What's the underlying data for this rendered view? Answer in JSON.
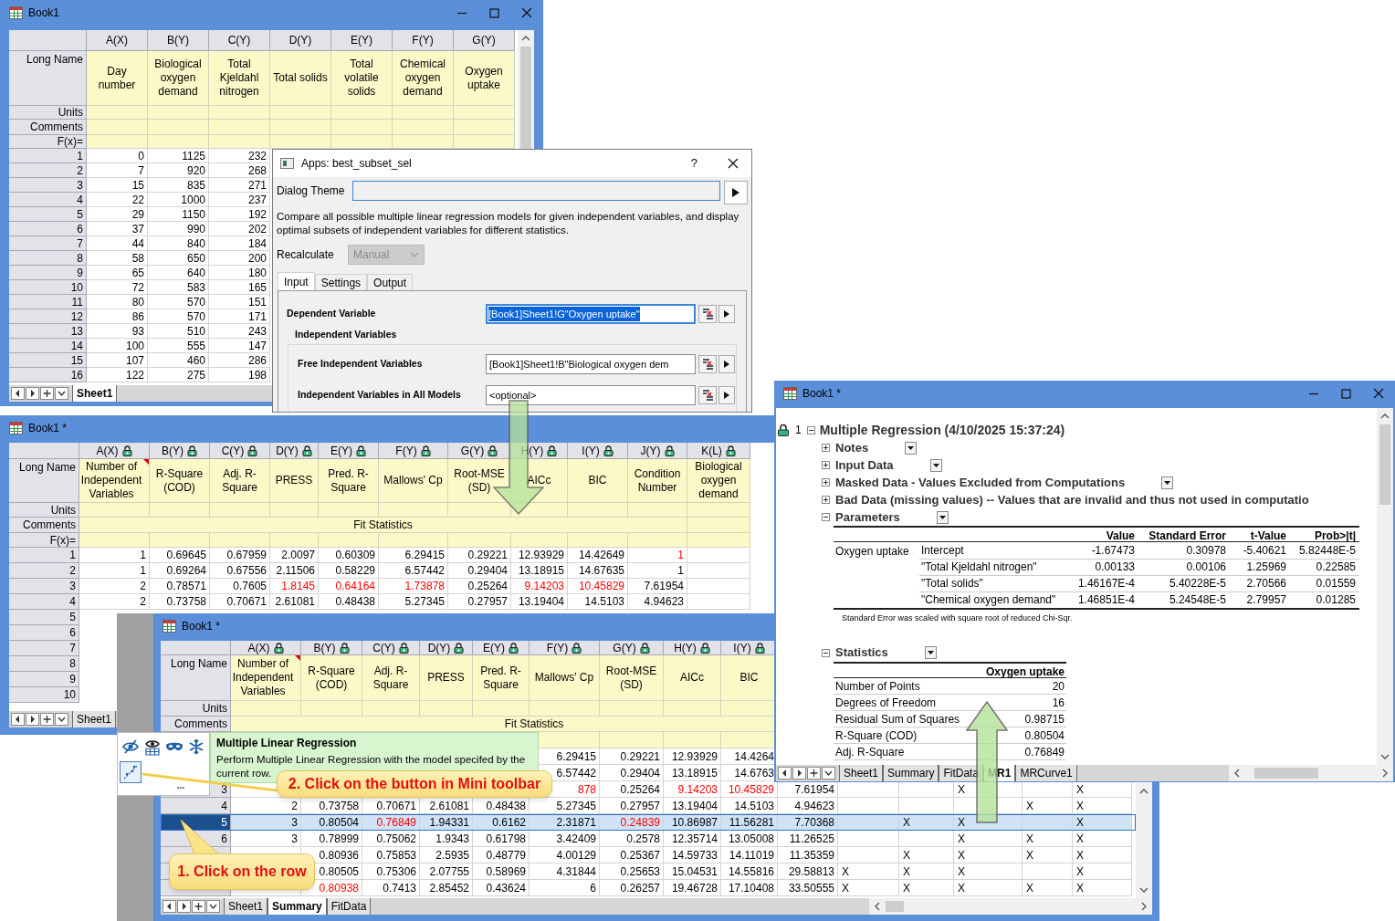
{
  "book1": {
    "title": "Book1",
    "columns": [
      {
        "name": "A(X)",
        "long_name": "Day number"
      },
      {
        "name": "B(Y)",
        "long_name": "Biological oxygen demand"
      },
      {
        "name": "C(Y)",
        "long_name": "Total Kjeldahl nitrogen"
      },
      {
        "name": "D(Y)",
        "long_name": "Total solids"
      },
      {
        "name": "E(Y)",
        "long_name": "Total volatile solids"
      },
      {
        "name": "F(Y)",
        "long_name": "Chemical oxygen demand"
      },
      {
        "name": "G(Y)",
        "long_name": "Oxygen uptake"
      }
    ],
    "row_labels": [
      "Long Name",
      "Units",
      "Comments",
      "F(x)="
    ],
    "rows": [
      {
        "number": "1",
        "cells": [
          "0",
          "1125",
          "232"
        ]
      },
      {
        "number": "2",
        "cells": [
          "7",
          "920",
          "268"
        ]
      },
      {
        "number": "3",
        "cells": [
          "15",
          "835",
          "271"
        ]
      },
      {
        "number": "4",
        "cells": [
          "22",
          "1000",
          "237"
        ]
      },
      {
        "number": "5",
        "cells": [
          "29",
          "1150",
          "192"
        ]
      },
      {
        "number": "6",
        "cells": [
          "37",
          "990",
          "202"
        ]
      },
      {
        "number": "7",
        "cells": [
          "44",
          "840",
          "184"
        ]
      },
      {
        "number": "8",
        "cells": [
          "58",
          "650",
          "200"
        ]
      },
      {
        "number": "9",
        "cells": [
          "65",
          "640",
          "180"
        ]
      },
      {
        "number": "10",
        "cells": [
          "72",
          "583",
          "165"
        ]
      },
      {
        "number": "11",
        "cells": [
          "80",
          "570",
          "151"
        ]
      },
      {
        "number": "12",
        "cells": [
          "86",
          "570",
          "171"
        ]
      },
      {
        "number": "13",
        "cells": [
          "93",
          "510",
          "243"
        ]
      },
      {
        "number": "14",
        "cells": [
          "100",
          "555",
          "147"
        ]
      },
      {
        "number": "15",
        "cells": [
          "107",
          "460",
          "286"
        ]
      },
      {
        "number": "16",
        "cells": [
          "122",
          "275",
          "198"
        ]
      }
    ],
    "sheet_tabs": [
      {
        "label": "Sheet1",
        "selected": true
      }
    ]
  },
  "app_dialog": {
    "title": "Apps: best_subset_sel",
    "help": "?",
    "theme_label": "Dialog Theme",
    "description": "Compare all possible multiple linear regression models for given independent variables, and display optimal subsets of independent variables for different statistics.",
    "recalculate_label": "Recalculate",
    "recalculate": {
      "value": "Manual",
      "disabled": true
    },
    "tabs": [
      {
        "label": "Input",
        "selected": true
      },
      {
        "label": "Settings",
        "selected": false
      },
      {
        "label": "Output",
        "selected": false
      }
    ],
    "dependent": {
      "label": "Dependent Variable",
      "value": "[Book1]Sheet1!G\"Oxygen uptake\"",
      "text_selected": true
    },
    "group_label": "Independent Variables",
    "free": {
      "label": "Free Independent Variables",
      "value": "[Book1]Sheet1!B\"Biological oxygen dem"
    },
    "all_models": {
      "label": "Independent Variables in All Models",
      "placeholder": "<optional>"
    }
  },
  "summary_back": {
    "title": "Book1 *",
    "columns": [
      {
        "name": "A(X)",
        "locked": true,
        "comment_mark": true,
        "long_name": "Number of Independent Variables"
      },
      {
        "name": "B(Y)",
        "locked": true,
        "comment_mark": false,
        "long_name": "R-Square (COD)"
      },
      {
        "name": "C(Y)",
        "locked": true,
        "comment_mark": false,
        "long_name": "Adj. R-Square"
      },
      {
        "name": "D(Y)",
        "locked": true,
        "comment_mark": false,
        "long_name": "PRESS"
      },
      {
        "name": "E(Y)",
        "locked": true,
        "comment_mark": false,
        "long_name": "Pred. R-Square"
      },
      {
        "name": "F(Y)",
        "locked": true,
        "comment_mark": false,
        "long_name": "Mallows' Cp"
      },
      {
        "name": "G(Y)",
        "locked": true,
        "comment_mark": false,
        "long_name": "Root-MSE (SD)"
      },
      {
        "name": "H(Y)",
        "locked": true,
        "comment_mark": false,
        "long_name": "AICc"
      },
      {
        "name": "I(Y)",
        "locked": true,
        "comment_mark": false,
        "long_name": "BIC"
      },
      {
        "name": "J(Y)",
        "locked": true,
        "comment_mark": false,
        "long_name": "Condition Number"
      },
      {
        "name": "K(L)",
        "locked": true,
        "comment_mark": false,
        "long_name": "Biological oxygen demand"
      }
    ],
    "row_labels": [
      "Long Name",
      "Units",
      "Comments",
      "F(x)="
    ],
    "comments": "Fit Statistics",
    "rows": [
      {
        "number": "1",
        "cells": [
          "1",
          "0.69645",
          "0.67959",
          "2.0097",
          "0.60309",
          "6.29415",
          "0.29221",
          "12.93929",
          "14.42649",
          {
            "text": "1",
            "flagged": true
          }
        ]
      },
      {
        "number": "2",
        "cells": [
          "1",
          "0.69264",
          "0.67556",
          "2.11506",
          "0.58229",
          "6.57442",
          "0.29404",
          "13.18915",
          "14.67635",
          "1"
        ]
      },
      {
        "number": "3",
        "cells": [
          "2",
          "0.78571",
          "0.7605",
          {
            "text": "1.8145",
            "flagged": true
          },
          {
            "text": "0.64164",
            "flagged": true
          },
          {
            "text": "1.73878",
            "flagged": true
          },
          "0.25264",
          {
            "text": "9.14203",
            "flagged": true
          },
          {
            "text": "10.45829",
            "flagged": true
          },
          "7.61954"
        ]
      },
      {
        "number": "4",
        "cells": [
          "2",
          "0.73758",
          "0.70671",
          "2.61081",
          "0.48438",
          "5.27345",
          "0.27957",
          "13.19404",
          "14.5103",
          "4.94623"
        ]
      },
      {
        "number": "5"
      },
      {
        "number": "6"
      },
      {
        "number": "7"
      },
      {
        "number": "8"
      },
      {
        "number": "9"
      },
      {
        "number": "10"
      }
    ],
    "sheet_tabs": [
      {
        "label": "Sheet1",
        "selected": false
      }
    ]
  },
  "summary_front": {
    "title": "Book1 *",
    "columns": [
      {
        "name": "A(X)",
        "locked": true,
        "comment_mark": true,
        "long_name": "Number of Independent Variables"
      },
      {
        "name": "B(Y)",
        "locked": true,
        "comment_mark": false,
        "long_name": "R-Square (COD)"
      },
      {
        "name": "C(Y)",
        "locked": true,
        "comment_mark": false,
        "long_name": "Adj. R-Square"
      },
      {
        "name": "D(Y)",
        "locked": true,
        "comment_mark": false,
        "long_name": "PRESS"
      },
      {
        "name": "E(Y)",
        "locked": true,
        "comment_mark": false,
        "long_name": "Pred. R-Square"
      },
      {
        "name": "F(Y)",
        "locked": true,
        "comment_mark": false,
        "long_name": "Mallows' Cp"
      },
      {
        "name": "G(Y)",
        "locked": true,
        "comment_mark": false,
        "long_name": "Root-MSE (SD)"
      },
      {
        "name": "H(Y)",
        "locked": true,
        "comment_mark": false,
        "long_name": "AICc"
      },
      {
        "name": "I(Y)",
        "locked": true,
        "comment_mark": false,
        "long_name": "BIC"
      }
    ],
    "row_labels": [
      "Long Name",
      "Units",
      "Comments"
    ],
    "comments": "Fit Statistics",
    "rows": [
      {
        "selected": false,
        "cells": [
          null,
          null,
          null,
          null,
          null,
          "6.29415",
          "0.29221",
          "12.93929",
          "14.4264"
        ]
      },
      {
        "selected": false,
        "cells": [
          null,
          null,
          null,
          null,
          null,
          "6.57442",
          "0.29404",
          "13.18915",
          "14.6763"
        ]
      },
      {
        "number": "3",
        "selected": false,
        "cells": [
          null,
          null,
          null,
          null,
          null,
          {
            "text": "878",
            "flagged": true
          },
          "0.25264",
          {
            "text": "9.14203",
            "flagged": true
          },
          {
            "text": "10.45829",
            "flagged": true
          },
          "7.61954",
          null,
          null,
          "X",
          null,
          "X"
        ]
      },
      {
        "number": "4",
        "selected": false,
        "cells": [
          "2",
          "0.73758",
          "0.70671",
          "2.61081",
          "0.48438",
          "5.27345",
          "0.27957",
          "13.19404",
          "14.5103",
          "4.94623",
          null,
          null,
          null,
          "X",
          "X"
        ]
      },
      {
        "number": "5",
        "selected": true,
        "cells": [
          "3",
          "0.80504",
          {
            "text": "0.76849",
            "flagged": true
          },
          "1.94331",
          "0.6162",
          "2.31871",
          {
            "text": "0.24839",
            "flagged": true
          },
          "10.86987",
          "11.56281",
          "7.70368",
          null,
          "X",
          "X",
          null,
          "X"
        ]
      },
      {
        "number": "6",
        "selected": false,
        "cells": [
          "3",
          "0.78999",
          "0.75062",
          "1.9343",
          "0.61798",
          "3.42409",
          "0.2578",
          "12.35714",
          "13.05008",
          "11.26525",
          null,
          null,
          "X",
          "X",
          "X"
        ]
      },
      {
        "selected": false,
        "cells": [
          null,
          "0.80936",
          "0.75853",
          "2.5935",
          "0.48779",
          "4.00129",
          "0.25367",
          "14.59733",
          "14.11019",
          "11.35359",
          null,
          "X",
          "X",
          "X",
          "X"
        ]
      },
      {
        "selected": false,
        "cells": [
          null,
          "0.80505",
          "0.75306",
          "2.07755",
          "0.58969",
          "4.31844",
          "0.25653",
          "15.04531",
          "14.55816",
          "29.58813",
          "X",
          "X",
          "X",
          null,
          "X"
        ]
      },
      {
        "selected": false,
        "cells": [
          null,
          {
            "text": "0.80938",
            "flagged": true
          },
          "0.7413",
          "2.85452",
          "0.43624",
          "6",
          "0.26257",
          "19.46728",
          "17.10408",
          "33.50555",
          "X",
          "X",
          "X",
          "X",
          "X"
        ]
      }
    ],
    "sheet_tabs": [
      {
        "label": "Sheet1",
        "selected": false
      },
      {
        "label": "Summary",
        "selected": true
      },
      {
        "label": "FitData",
        "selected": false
      }
    ]
  },
  "report": {
    "title": "Book1 *",
    "index": "1",
    "heading": "Multiple Regression (4/10/2025 15:37:24)",
    "expanded": true,
    "sections": [
      {
        "kind": "section",
        "title": "Notes",
        "expanded": false,
        "menu": true
      },
      {
        "kind": "section",
        "title": "Input Data",
        "expanded": false,
        "menu": true
      },
      {
        "kind": "section",
        "title": "Masked Data - Values Excluded from Computations",
        "expanded": false,
        "menu": true
      },
      {
        "kind": "section",
        "title": "Bad Data (missing values) -- Values that are invalid and thus not used in computatio",
        "expanded": false,
        "menu": false
      },
      {
        "kind": "parameters",
        "title": "Parameters",
        "expanded": true,
        "menu": true,
        "columns": [
          "Value",
          "Standard Error",
          "t-Value",
          "Prob>|t|"
        ],
        "group": "Oxygen uptake",
        "rows": [
          {
            "name": "Intercept",
            "values": [
              "-1.67473",
              "0.30978",
              "-5.40621",
              "5.82448E-5"
            ]
          },
          {
            "name": "\"Total Kjeldahl nitrogen\"",
            "values": [
              "0.00133",
              "0.00106",
              "1.25969",
              "0.22585"
            ]
          },
          {
            "name": "\"Total solids\"",
            "values": [
              "1.46167E-4",
              "5.40228E-5",
              "2.70566",
              "0.01559"
            ]
          },
          {
            "name": "\"Chemical oxygen demand\"",
            "values": [
              "1.46851E-4",
              "5.24548E-5",
              "2.79957",
              "0.01285"
            ]
          }
        ],
        "note": "Standard Error was scaled with square root of reduced Chi-Sqr."
      },
      {
        "kind": "statistics",
        "title": "Statistics",
        "expanded": true,
        "menu": true,
        "column": "Oxygen uptake",
        "rows": [
          {
            "label": "Number of Points",
            "value": "20"
          },
          {
            "label": "Degrees of Freedom",
            "value": "16"
          },
          {
            "label": "Residual Sum of Squares",
            "value": "0.98715"
          },
          {
            "label": "R-Square (COD)",
            "value": "0.80504"
          },
          {
            "label": "Adj. R-Square",
            "value": "0.76849"
          }
        ]
      }
    ],
    "sheet_tabs": [
      {
        "label": "Sheet1",
        "selected": false
      },
      {
        "label": "Summary",
        "selected": false
      },
      {
        "label": "FitData",
        "selected": false
      },
      {
        "label": "MR1",
        "selected": true
      },
      {
        "label": "MRCurve1",
        "selected": false
      }
    ]
  },
  "mini_toolbar": {
    "buttons": [
      {
        "kind": "hide",
        "selected": false
      },
      {
        "kind": "show",
        "selected": false
      },
      {
        "kind": "mask",
        "selected": false
      },
      {
        "kind": "freeze",
        "selected": false
      },
      {
        "kind": "regression",
        "selected": true
      }
    ],
    "more": "•••"
  },
  "tooltip": {
    "title": "Multiple Linear Regression",
    "text": "Perform Multiple Linear Regression with the model specifed by the current row."
  },
  "callouts": [
    {
      "text": "1. Click on the row"
    },
    {
      "text": "2. Click on the button in Mini toolbar"
    }
  ]
}
